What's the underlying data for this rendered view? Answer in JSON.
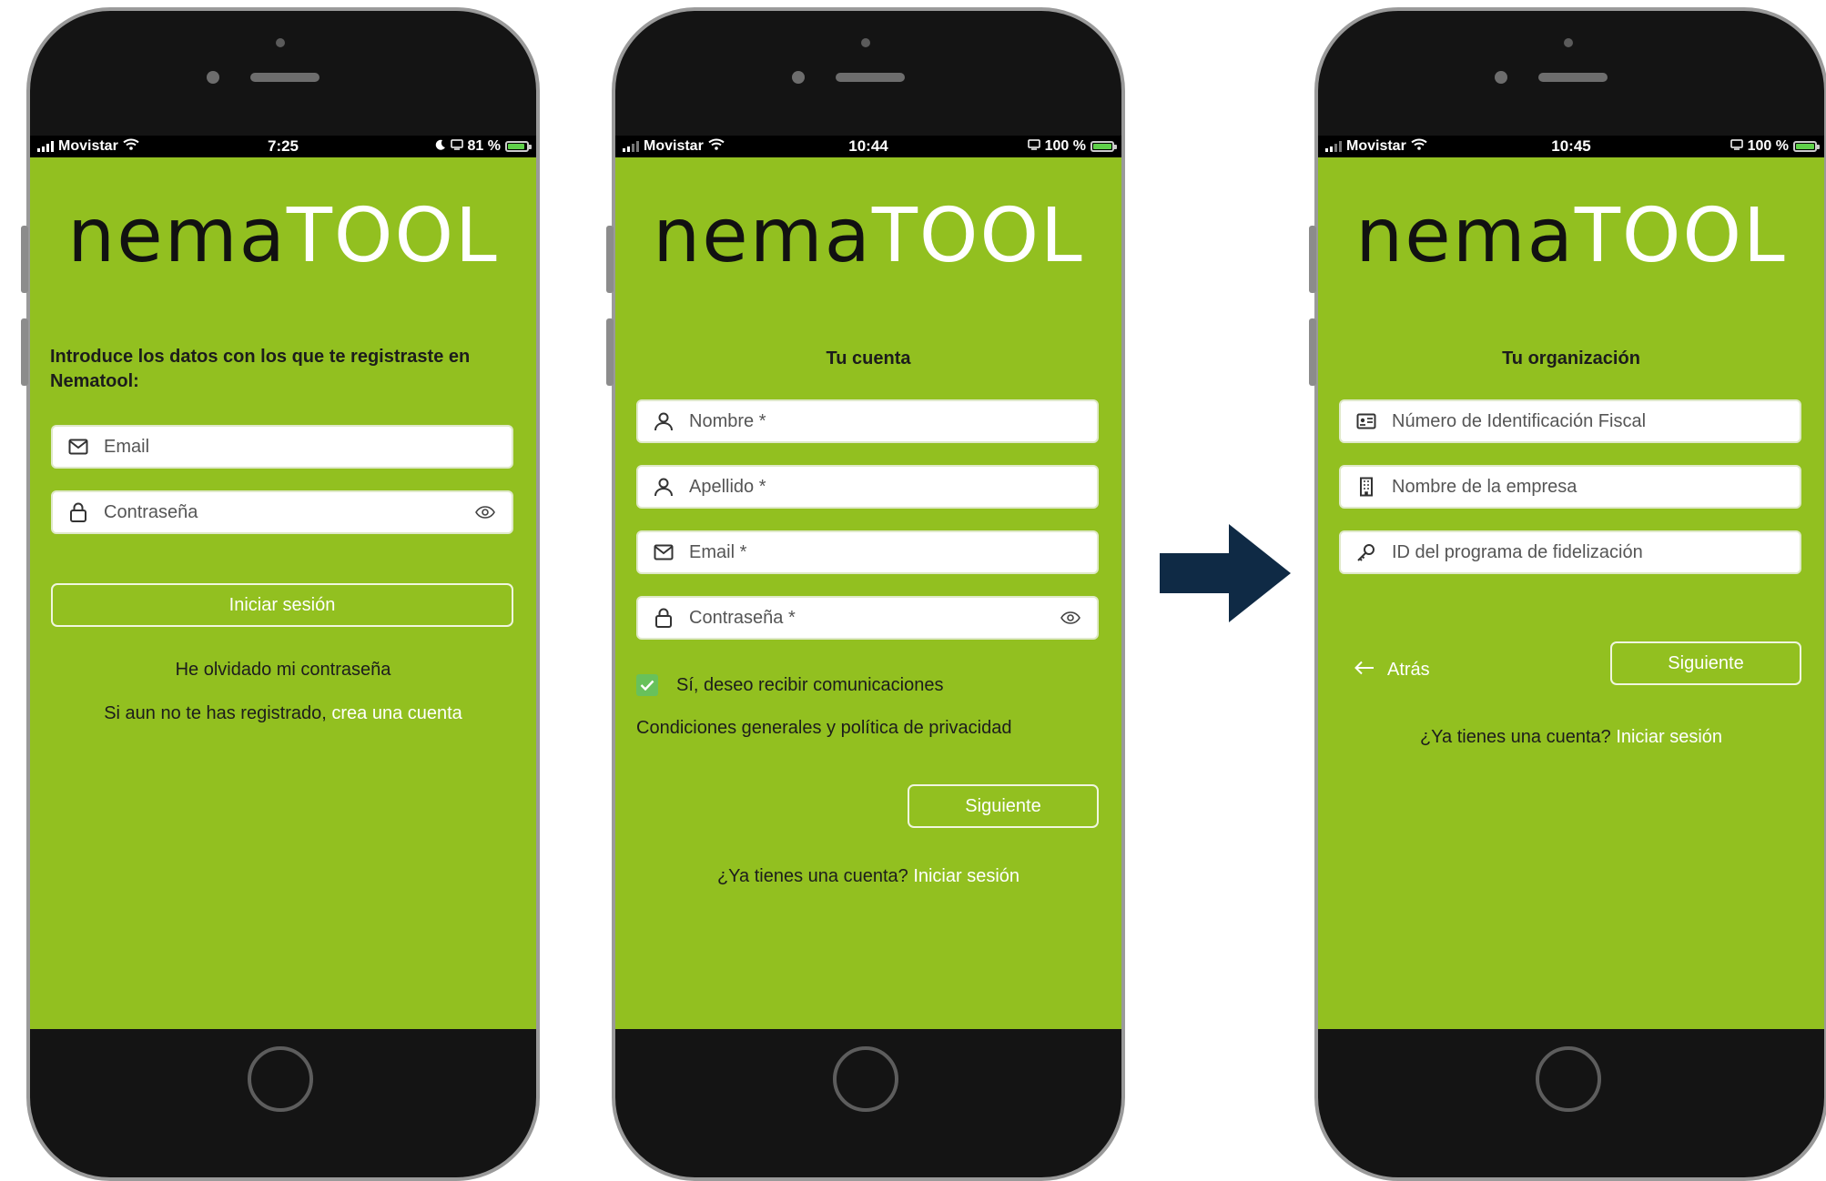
{
  "colors": {
    "screen_bg": "#92c020",
    "arrow": "#0f2a45",
    "check": "#68c15b"
  },
  "phone1": {
    "status": {
      "carrier": "Movistar",
      "time": "7:25",
      "battery": "81 %"
    },
    "logo": {
      "part1": "nema",
      "part2": "TOOL"
    },
    "intro": "Introduce los datos con los que te registraste en Nematool:",
    "fields": [
      {
        "icon": "envelope-icon",
        "placeholder": "Email"
      },
      {
        "icon": "lock-icon",
        "placeholder": "Contraseña"
      }
    ],
    "login_button": "Iniciar sesión",
    "forgot_password": "He olvidado mi contraseña",
    "register_text": "Si aun no te has registrado,",
    "register_link": "crea una cuenta"
  },
  "phone2": {
    "status": {
      "carrier": "Movistar",
      "time": "10:44",
      "battery": "100 %"
    },
    "logo": {
      "part1": "nema",
      "part2": "TOOL"
    },
    "title": "Tu cuenta",
    "fields": [
      {
        "icon": "user-icon",
        "placeholder": "Nombre *"
      },
      {
        "icon": "user-icon",
        "placeholder": "Apellido *"
      },
      {
        "icon": "envelope-icon",
        "placeholder": "Email *"
      },
      {
        "icon": "lock-icon",
        "placeholder": "Contraseña *"
      }
    ],
    "checkbox_label": "Sí, deseo recibir comunicaciones",
    "terms_link": "Condiciones generales y política de privacidad",
    "next_button": "Siguiente",
    "have_account": "¿Ya tienes una cuenta?",
    "login_link": "Iniciar sesión"
  },
  "phone3": {
    "status": {
      "carrier": "Movistar",
      "time": "10:45",
      "battery": "100 %"
    },
    "logo": {
      "part1": "nema",
      "part2": "TOOL"
    },
    "title": "Tu organización",
    "fields": [
      {
        "icon": "id-card-icon",
        "placeholder": "Número de Identificación Fiscal"
      },
      {
        "icon": "building-icon",
        "placeholder": "Nombre de la empresa"
      },
      {
        "icon": "key-icon",
        "placeholder": "ID del programa de fidelización"
      }
    ],
    "back_button": "Atrás",
    "next_button": "Siguiente",
    "have_account": "¿Ya tienes una cuenta?",
    "login_link": "Iniciar sesión"
  }
}
